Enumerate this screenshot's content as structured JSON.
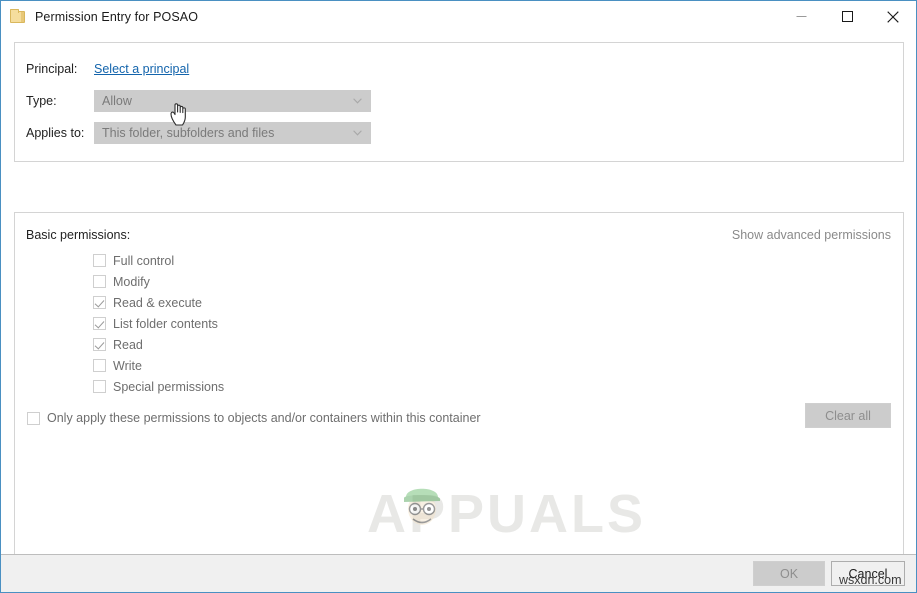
{
  "window": {
    "title": "Permission Entry for POSAO",
    "icon": "folder-icon",
    "controls": {
      "minimize": "minimize-icon",
      "maximize": "maximize-icon",
      "close": "close-icon"
    }
  },
  "form": {
    "principal": {
      "label": "Principal:",
      "link_text": "Select a principal"
    },
    "type": {
      "label": "Type:",
      "value": "Allow"
    },
    "applies_to": {
      "label": "Applies to:",
      "value": "This folder, subfolders and files"
    }
  },
  "permissions": {
    "section_label": "Basic permissions:",
    "advanced_link": "Show advanced permissions",
    "items": [
      {
        "label": "Full control",
        "checked": false
      },
      {
        "label": "Modify",
        "checked": false
      },
      {
        "label": "Read & execute",
        "checked": true
      },
      {
        "label": "List folder contents",
        "checked": true
      },
      {
        "label": "Read",
        "checked": true
      },
      {
        "label": "Write",
        "checked": false
      },
      {
        "label": "Special permissions",
        "checked": false
      }
    ],
    "only_apply": {
      "label": "Only apply these permissions to objects and/or containers within this container",
      "checked": false
    },
    "clear_all_label": "Clear all"
  },
  "footer": {
    "ok_label": "OK",
    "cancel_label": "Cancel"
  },
  "watermark": {
    "brand": "APPUALS",
    "site": "wsxdn.com"
  },
  "colors": {
    "window_border": "#4a90c2",
    "link": "#1364ac",
    "disabled_text": "#6e6e6e",
    "field_bg": "#cccccc",
    "footer_bg": "#f0f0f0"
  }
}
